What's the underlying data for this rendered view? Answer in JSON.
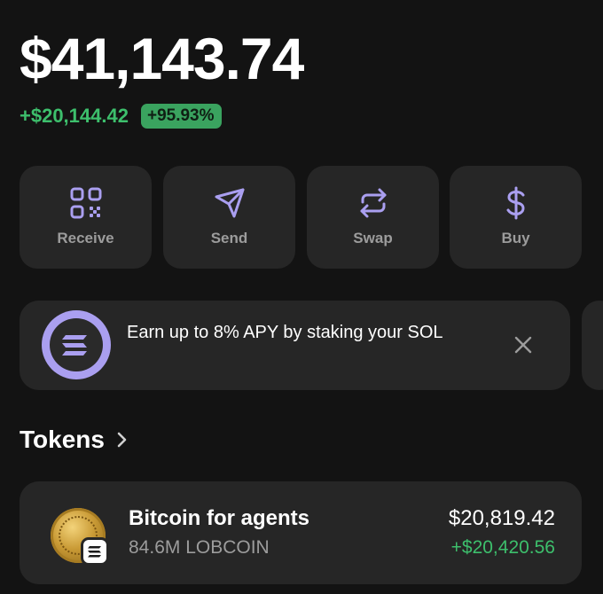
{
  "wallet": {
    "balance": "$41,143.74",
    "change_amount": "+$20,144.42",
    "change_percent": "+95.93%"
  },
  "actions": [
    {
      "label": "Receive",
      "icon": "qr-code-icon"
    },
    {
      "label": "Send",
      "icon": "send-icon"
    },
    {
      "label": "Swap",
      "icon": "swap-icon"
    },
    {
      "label": "Buy",
      "icon": "dollar-icon"
    }
  ],
  "promo": {
    "text": "Earn up to 8% APY by staking your SOL",
    "icon": "solana-icon",
    "close_icon": "close-icon"
  },
  "tokens_section": {
    "title": "Tokens",
    "chevron_icon": "chevron-right-icon"
  },
  "tokens": [
    {
      "name": "Bitcoin for agents",
      "amount": "84.6M LOBCOIN",
      "value": "$20,819.42",
      "change": "+$20,420.56",
      "icon": "coin-icon",
      "chain_icon": "solana-icon"
    }
  ],
  "colors": {
    "background": "#131313",
    "card": "#262626",
    "accent": "#aa9ff0",
    "positive": "#3dbf6c",
    "muted": "#9c9c9c"
  }
}
